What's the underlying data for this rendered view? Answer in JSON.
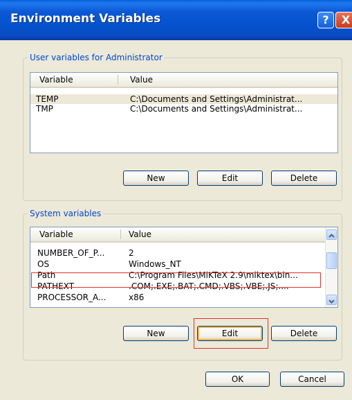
{
  "window": {
    "title": "Environment Variables",
    "help_label": "?",
    "close_label": "X"
  },
  "user_group": {
    "label": "User variables for Administrator",
    "columns": [
      "Variable",
      "Value"
    ],
    "rows": [
      {
        "variable": "TEMP",
        "value": "C:\\Documents and Settings\\Administrat..."
      },
      {
        "variable": "TMP",
        "value": "C:\\Documents and Settings\\Administrat..."
      }
    ],
    "buttons": {
      "new": "New",
      "edit": "Edit",
      "delete": "Delete"
    }
  },
  "system_group": {
    "label": "System variables",
    "columns": [
      "Variable",
      "Value"
    ],
    "rows": [
      {
        "variable": "NUMBER_OF_P...",
        "value": "2"
      },
      {
        "variable": "OS",
        "value": "Windows_NT"
      },
      {
        "variable": "Path",
        "value": "C:\\Program Files\\MiKTeX 2.9\\miktex\\bin..."
      },
      {
        "variable": "PATHEXT",
        "value": ".COM;.EXE;.BAT;.CMD;.VBS;.VBE;.JS;...."
      },
      {
        "variable": "PROCESSOR_A...",
        "value": "x86"
      }
    ],
    "buttons": {
      "new": "New",
      "edit": "Edit",
      "delete": "Delete"
    }
  },
  "footer": {
    "ok": "OK",
    "cancel": "Cancel"
  },
  "colors": {
    "title_bar": "#0453cf",
    "dialog": "#ece9d8",
    "highlight": "#e03030",
    "group_label": "#0046d5"
  }
}
